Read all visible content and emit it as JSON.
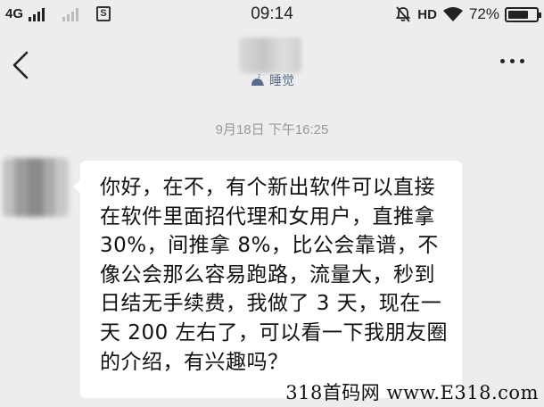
{
  "status_bar": {
    "network_type": "4G",
    "sim_label": "S",
    "time": "09:14",
    "hd_label": "HD",
    "battery_percent": "72%",
    "battery_level": 0.72,
    "icons": [
      "signal-bars-icon",
      "sim-icon",
      "mute-bell-icon",
      "wifi-icon",
      "battery-icon"
    ]
  },
  "nav": {
    "back_icon": "chevron-left-icon",
    "more_icon": "more-dots-icon",
    "contact_status": "睡觉",
    "status_icon": "sleep-moon-icon"
  },
  "chat": {
    "timestamp": "9月18日 下午16:25",
    "messages": [
      {
        "from": "contact",
        "text": "你好，在不，有个新出软件可以直接在软件里面招代理和女用户，直推拿 30%，间推拿 8%，比公会靠谱，不像公会那么容易跑路，流量大，秒到日结无手续费，我做了 3 天，现在一天 200 左右了，可以看一下我朋友圈的介绍，有兴趣吗？"
      }
    ]
  },
  "watermark": "318首码网 www.E318.com",
  "colors": {
    "background": "#ededed",
    "bubble": "#ffffff",
    "timestamp": "#999999",
    "status_text": "#5a6b8c"
  }
}
